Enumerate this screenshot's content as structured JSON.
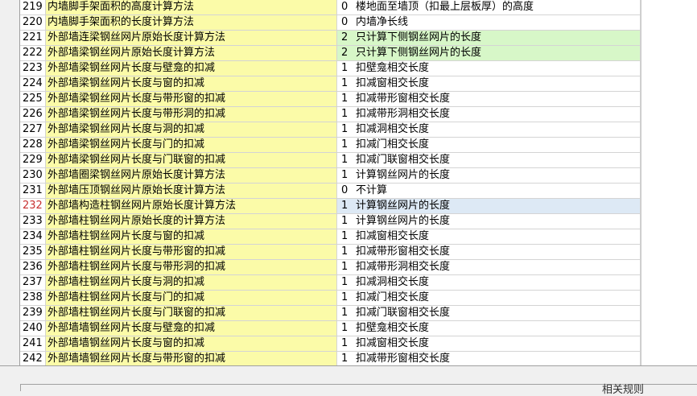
{
  "rows": [
    {
      "num": "219",
      "name": "内墙脚手架面积的高度计算方法",
      "code": "0",
      "text": "楼地面至墙顶（扣最上层板厚）的高度",
      "hl": ""
    },
    {
      "num": "220",
      "name": "内墙脚手架面积的长度计算方法",
      "code": "0",
      "text": "内墙净长线",
      "hl": ""
    },
    {
      "num": "221",
      "name": "外部墙连梁钢丝网片原始长度计算方法",
      "code": "2",
      "text": "只计算下侧钢丝网片的长度",
      "hl": "green"
    },
    {
      "num": "222",
      "name": "外部墙梁钢丝网片原始长度计算方法",
      "code": "2",
      "text": "只计算下侧钢丝网片的长度",
      "hl": "green"
    },
    {
      "num": "223",
      "name": "外部墙梁钢丝网片长度与壁龛的扣减",
      "code": "1",
      "text": "扣壁龛相交长度",
      "hl": ""
    },
    {
      "num": "224",
      "name": "外部墙梁钢丝网片长度与窗的扣减",
      "code": "1",
      "text": "扣减窗相交长度",
      "hl": ""
    },
    {
      "num": "225",
      "name": "外部墙梁钢丝网片长度与带形窗的扣减",
      "code": "1",
      "text": "扣减带形窗相交长度",
      "hl": ""
    },
    {
      "num": "226",
      "name": "外部墙梁钢丝网片长度与带形洞的扣减",
      "code": "1",
      "text": "扣减带形洞相交长度",
      "hl": ""
    },
    {
      "num": "227",
      "name": "外部墙梁钢丝网片长度与洞的扣减",
      "code": "1",
      "text": "扣减洞相交长度",
      "hl": ""
    },
    {
      "num": "228",
      "name": "外部墙梁钢丝网片长度与门的扣减",
      "code": "1",
      "text": "扣减门相交长度",
      "hl": ""
    },
    {
      "num": "229",
      "name": "外部墙梁钢丝网片长度与门联窗的扣减",
      "code": "1",
      "text": "扣减门联窗相交长度",
      "hl": ""
    },
    {
      "num": "230",
      "name": "外部墙圈梁钢丝网片原始长度计算方法",
      "code": "1",
      "text": "计算钢丝网片的长度",
      "hl": ""
    },
    {
      "num": "231",
      "name": "外部墙压顶钢丝网片原始长度计算方法",
      "code": "0",
      "text": "不计算",
      "hl": ""
    },
    {
      "num": "232",
      "name": "外部墙构造柱钢丝网片原始长度计算方法",
      "code": "1",
      "text": "计算钢丝网片的长度",
      "hl": "blue"
    },
    {
      "num": "233",
      "name": "外部墙柱钢丝网片原始长度的计算方法",
      "code": "1",
      "text": "计算钢丝网片的长度",
      "hl": ""
    },
    {
      "num": "234",
      "name": "外部墙柱钢丝网片长度与窗的扣减",
      "code": "1",
      "text": "扣减窗相交长度",
      "hl": ""
    },
    {
      "num": "235",
      "name": "外部墙柱钢丝网片长度与带形窗的扣减",
      "code": "1",
      "text": "扣减带形窗相交长度",
      "hl": ""
    },
    {
      "num": "236",
      "name": "外部墙柱钢丝网片长度与带形洞的扣减",
      "code": "1",
      "text": "扣减带形洞相交长度",
      "hl": ""
    },
    {
      "num": "237",
      "name": "外部墙柱钢丝网片长度与洞的扣减",
      "code": "1",
      "text": "扣减洞相交长度",
      "hl": ""
    },
    {
      "num": "238",
      "name": "外部墙柱钢丝网片长度与门的扣减",
      "code": "1",
      "text": "扣减门相交长度",
      "hl": ""
    },
    {
      "num": "239",
      "name": "外部墙柱钢丝网片长度与门联窗的扣减",
      "code": "1",
      "text": "扣减门联窗相交长度",
      "hl": ""
    },
    {
      "num": "240",
      "name": "外部墙墙钢丝网片长度与壁龛的扣减",
      "code": "1",
      "text": "扣壁龛相交长度",
      "hl": ""
    },
    {
      "num": "241",
      "name": "外部墙墙钢丝网片长度与窗的扣减",
      "code": "1",
      "text": "扣减窗相交长度",
      "hl": ""
    },
    {
      "num": "242",
      "name": "外部墙墙钢丝网片长度与带形窗的扣减",
      "code": "1",
      "text": "扣减带形窗相交长度",
      "hl": ""
    }
  ],
  "current_row": "232",
  "status": {
    "text": "相关规则"
  },
  "colors": {
    "name_bg": "#fbfba8",
    "green_bg": "#d7f7c8",
    "blue_bg": "#dde9f5",
    "current_num": "#c83232"
  }
}
